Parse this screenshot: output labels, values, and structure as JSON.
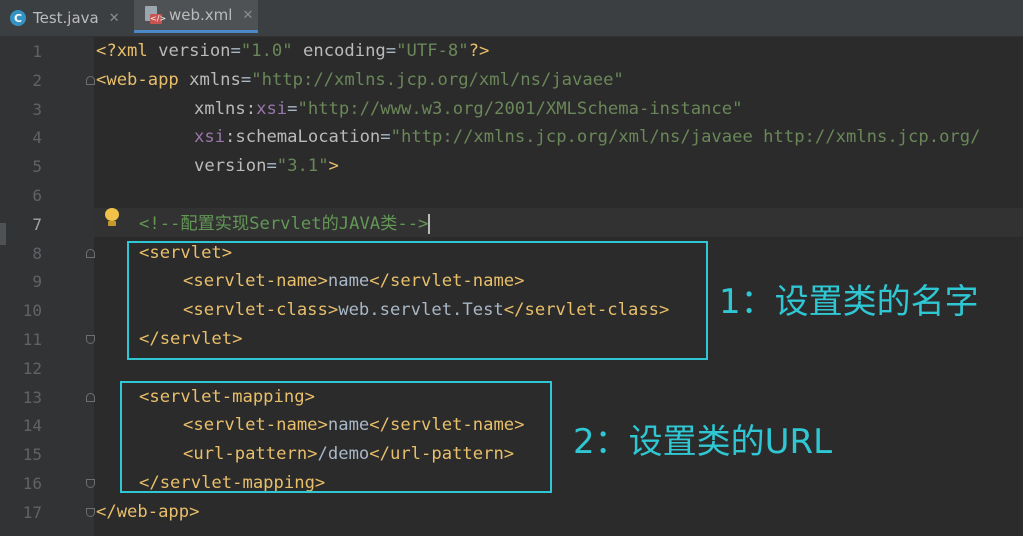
{
  "tabs": [
    {
      "label": "Test.java",
      "icon": "java-class-icon",
      "active": false
    },
    {
      "label": "web.xml",
      "icon": "xml-file-icon",
      "active": true
    }
  ],
  "line_numbers": [
    "1",
    "2",
    "3",
    "4",
    "5",
    "6",
    "7",
    "8",
    "9",
    "10",
    "11",
    "12",
    "13",
    "14",
    "15",
    "16",
    "17"
  ],
  "code": {
    "l1": {
      "a": "<?xml ",
      "b": "version",
      "c": "=",
      "d": "\"1.0\"",
      "e": " ",
      "f": "encoding",
      "g": "=",
      "h": "\"UTF-8\"",
      "i": "?>"
    },
    "l2": {
      "a": "<web-app ",
      "b": "xmlns",
      "c": "=",
      "d": "\"http://xmlns.jcp.org/xml/ns/javaee\""
    },
    "l3": {
      "a": "xmlns:",
      "b": "xsi",
      "c": "=",
      "d": "\"http://www.w3.org/2001/XMLSchema-instance\""
    },
    "l4": {
      "a": "xsi",
      ":": ":",
      "b": "schemaLocation",
      "c": "=",
      "d": "\"http://xmlns.jcp.org/xml/ns/javaee http://xmlns.jcp.org/"
    },
    "l5": {
      "a": "version",
      "c": "=",
      "d": "\"3.1\"",
      "e": ">"
    },
    "l7": {
      "comment": "<!--配置实现Servlet的JAVA类-->"
    },
    "l8": {
      "open": "<servlet>"
    },
    "l9": {
      "open": "<servlet-name>",
      "text": "name",
      "close": "</servlet-name>"
    },
    "l10": {
      "open": "<servlet-class>",
      "text": "web.servlet.Test",
      "close": "</servlet-class>"
    },
    "l11": {
      "close": "</servlet>"
    },
    "l13": {
      "open": "<servlet-mapping>"
    },
    "l14": {
      "open": "<servlet-name>",
      "text": "name",
      "close": "</servlet-name>"
    },
    "l15": {
      "open": "<url-pattern>",
      "text": "/demo",
      "close": "</url-pattern>"
    },
    "l16": {
      "close": "</servlet-mapping>"
    },
    "l17": {
      "close": "</web-app>"
    }
  },
  "annotations": {
    "note1": "1：设置类的名字",
    "note2": "2：设置类的URL"
  },
  "colors": {
    "annotation": "#2ec7d3",
    "editor_bg": "#2b2b2b",
    "tag": "#e8bf6a",
    "string": "#6a8759",
    "comment": "#629755"
  }
}
